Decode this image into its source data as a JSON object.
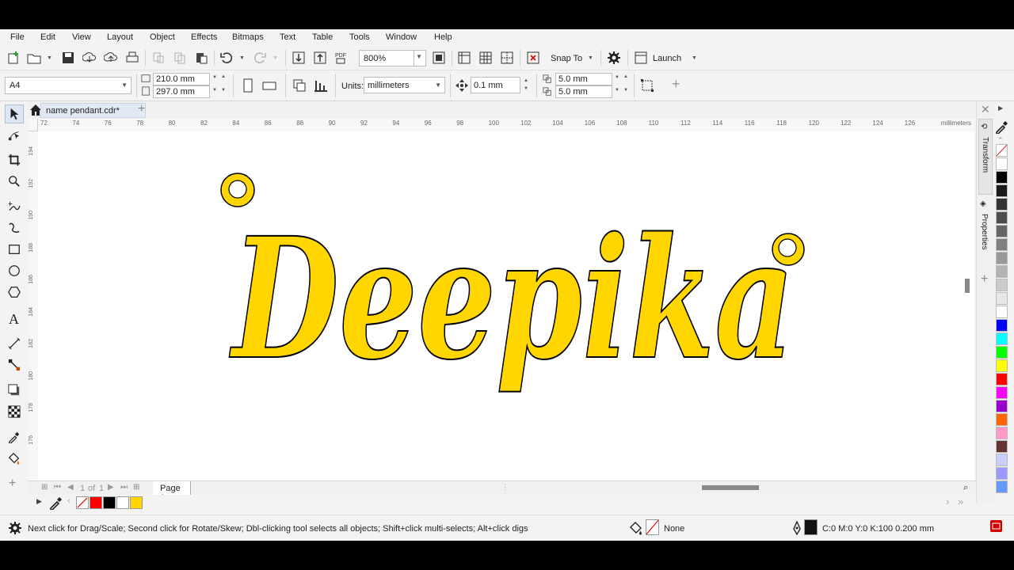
{
  "menu": [
    "File",
    "Edit",
    "View",
    "Layout",
    "Object",
    "Effects",
    "Bitmaps",
    "Text",
    "Table",
    "Tools",
    "Window",
    "Help"
  ],
  "toolbar": {
    "zoom": "800%",
    "snap_to": "Snap To",
    "launch": "Launch"
  },
  "property_bar": {
    "page_size": "A4",
    "width": "210.0 mm",
    "height": "297.0 mm",
    "units_label": "Units:",
    "units_value": "millimeters",
    "nudge": "0.1 mm",
    "dup_x": "5.0 mm",
    "dup_y": "5.0 mm"
  },
  "document_tab": "name pendant.cdr*",
  "ruler": {
    "h_ticks": [
      "72",
      "74",
      "76",
      "78",
      "80",
      "82",
      "84",
      "86",
      "88",
      "90",
      "92",
      "94",
      "96",
      "98",
      "100",
      "102",
      "104",
      "106",
      "108",
      "110",
      "112",
      "114",
      "116",
      "118",
      "120",
      "122",
      "124",
      "126"
    ],
    "h_units": "millimeters",
    "v_ticks": [
      "194",
      "192",
      "190",
      "188",
      "186",
      "184",
      "182",
      "180",
      "178",
      "176"
    ]
  },
  "artwork": {
    "text": "Deepika",
    "fill_color": "#FFD600",
    "outline_color": "#000000"
  },
  "page_nav": {
    "current": "1",
    "of_label": "of",
    "total": "1",
    "page_tab": "Page 1"
  },
  "document_palette": [
    "#ff0000",
    "#000000",
    "#ffffff",
    "#ffd600"
  ],
  "color_palette": [
    "#ffffff",
    "#000000",
    "#1a1a1a",
    "#333333",
    "#4d4d4d",
    "#666666",
    "#808080",
    "#999999",
    "#b3b3b3",
    "#cccccc",
    "#e6e6e6",
    "#ffffff",
    "#0000ff",
    "#00ffff",
    "#00ff00",
    "#ffff00",
    "#ff0000",
    "#ff00ff",
    "#9900cc",
    "#ff6600",
    "#ff99cc",
    "#663333",
    "#ccccff",
    "#9999ff",
    "#6699ff"
  ],
  "docker_tabs": [
    "Transform",
    "Properties"
  ],
  "status": {
    "hint": "Next click for Drag/Scale; Second click for Rotate/Skew; Dbl-clicking tool selects all objects; Shift+click multi-selects; Alt+click digs",
    "fill": "None",
    "outline": "C:0 M:0 Y:0 K:100  0.200 mm"
  }
}
